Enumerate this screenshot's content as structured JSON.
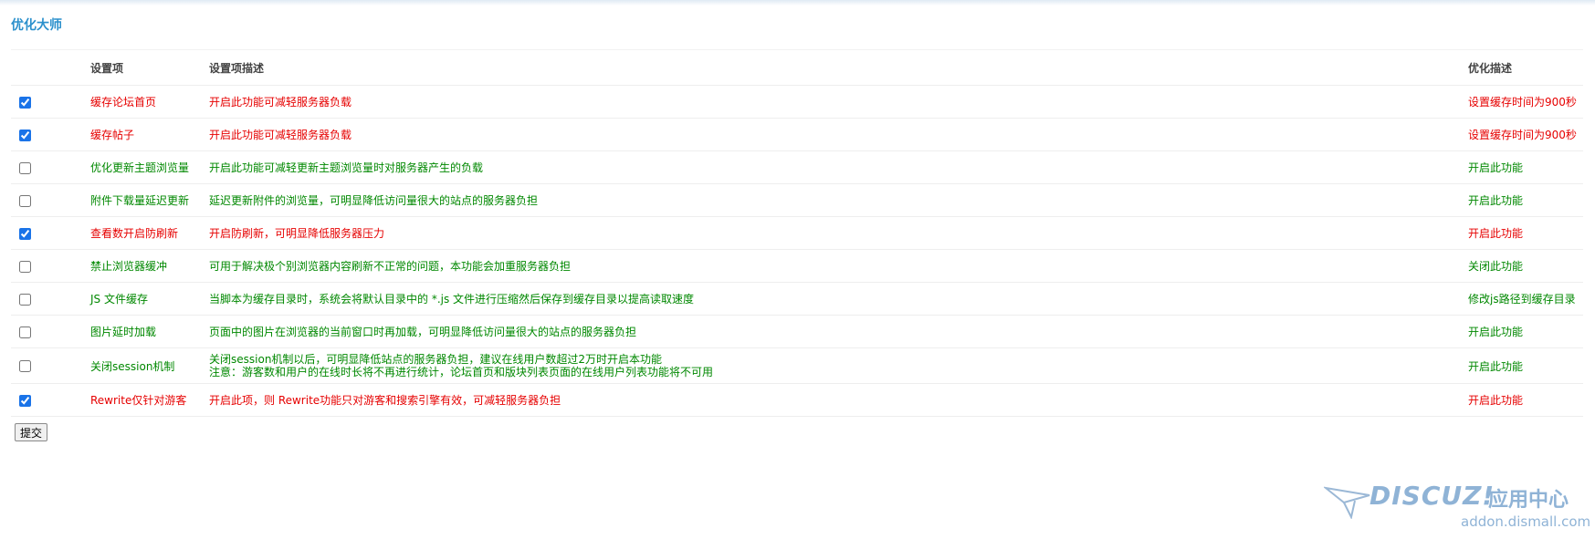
{
  "page": {
    "title": "优化大师"
  },
  "table": {
    "headers": [
      "设置项",
      "设置项描述",
      "优化描述"
    ],
    "rows": [
      {
        "checked": true,
        "name": "缓存论坛首页",
        "desc": [
          "开启此功能可减轻服务器负载"
        ],
        "opt": "设置缓存时间为900秒"
      },
      {
        "checked": true,
        "name": "缓存帖子",
        "desc": [
          "开启此功能可减轻服务器负载"
        ],
        "opt": "设置缓存时间为900秒"
      },
      {
        "checked": false,
        "name": "优化更新主题浏览量",
        "desc": [
          "开启此功能可减轻更新主题浏览量时对服务器产生的负载"
        ],
        "opt": "开启此功能"
      },
      {
        "checked": false,
        "name": "附件下载量延迟更新",
        "desc": [
          "延迟更新附件的浏览量，可明显降低访问量很大的站点的服务器负担"
        ],
        "opt": "开启此功能"
      },
      {
        "checked": true,
        "name": "查看数开启防刷新",
        "desc": [
          "开启防刷新，可明显降低服务器压力"
        ],
        "opt": "开启此功能"
      },
      {
        "checked": false,
        "name": "禁止浏览器缓冲",
        "desc": [
          "可用于解决极个别浏览器内容刷新不正常的问题，本功能会加重服务器负担"
        ],
        "opt": "关闭此功能"
      },
      {
        "checked": false,
        "name": "JS 文件缓存",
        "desc": [
          "当脚本为缓存目录时，系统会将默认目录中的 *.js 文件进行压缩然后保存到缓存目录以提高读取速度"
        ],
        "opt": "修改js路径到缓存目录"
      },
      {
        "checked": false,
        "name": "图片延时加载",
        "desc": [
          "页面中的图片在浏览器的当前窗口时再加载，可明显降低访问量很大的站点的服务器负担"
        ],
        "opt": "开启此功能"
      },
      {
        "checked": false,
        "name": "关闭session机制",
        "desc": [
          "关闭session机制以后，可明显降低站点的服务器负担，建议在线用户数超过2万时开启本功能",
          "注意：游客数和用户的在线时长将不再进行统计，论坛首页和版块列表页面的在线用户列表功能将不可用"
        ],
        "opt": "开启此功能"
      },
      {
        "checked": true,
        "name": "Rewrite仅针对游客",
        "desc": [
          "开启此项，则 Rewrite功能只对游客和搜索引擎有效，可减轻服务器负担"
        ],
        "opt": "开启此功能"
      }
    ]
  },
  "form": {
    "submit_label": "提交"
  },
  "watermark": {
    "brand": "DISCUZ!",
    "brand_cn": "应用中心",
    "url": "addon.dismall.com"
  },
  "colors": {
    "enabled": "#e60000",
    "disabled": "#008800",
    "title": "#2b90cc"
  }
}
